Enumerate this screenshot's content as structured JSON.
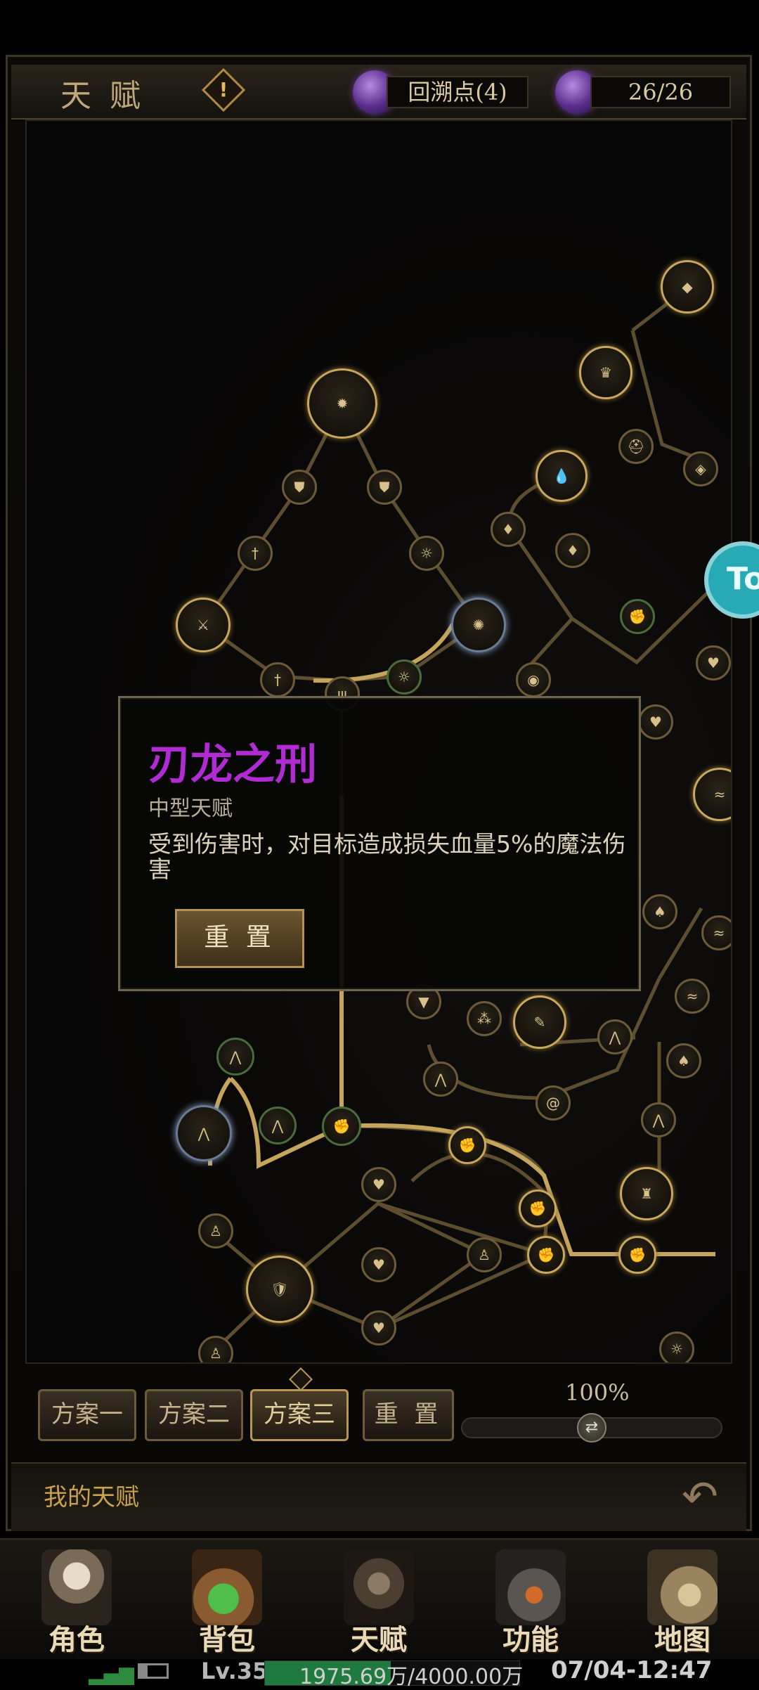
{
  "header": {
    "title": "天 赋",
    "warning_icon": "exclamation-diamond-icon",
    "rewind_points_label": "回溯点(4)",
    "talent_points": "26/26"
  },
  "popup": {
    "title": "刃龙之刑",
    "subtitle": "中型天赋",
    "description": "受到伤害时，对目标造成损失血量5%的魔法伤害",
    "reset_label": "重 置",
    "title_color": "#b12bd4"
  },
  "plans": {
    "items": [
      {
        "label": "方案一",
        "active": false
      },
      {
        "label": "方案二",
        "active": false
      },
      {
        "label": "方案三",
        "active": true
      }
    ],
    "reset_label": "重 置"
  },
  "zoom": {
    "label": "100%",
    "value_percent": 100
  },
  "footer": {
    "my_talent_label": "我的天赋"
  },
  "side_button": {
    "label": "To"
  },
  "nav": {
    "items": [
      {
        "label": "角色",
        "icon": "hooded-character-icon"
      },
      {
        "label": "背包",
        "icon": "backpack-potion-icon"
      },
      {
        "label": "天赋",
        "icon": "dragon-crest-icon",
        "active": true
      },
      {
        "label": "功能",
        "icon": "anvil-hammer-icon"
      },
      {
        "label": "地图",
        "icon": "map-compass-icon"
      }
    ]
  },
  "status": {
    "level": "Lv.35",
    "exp_text": "1975.69万/4000.00万",
    "exp_fraction": 0.494,
    "datetime": "07/04-12:47"
  }
}
